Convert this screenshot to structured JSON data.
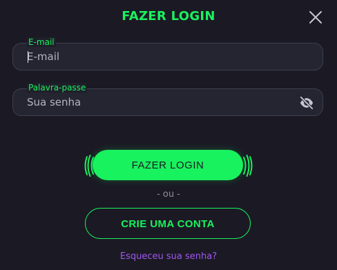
{
  "modal": {
    "title": "FAZER LOGIN"
  },
  "email": {
    "label": "E-mail",
    "placeholder": "E-mail",
    "value": ""
  },
  "password": {
    "label": "Palavra-passe",
    "placeholder": "Sua senha",
    "value": ""
  },
  "actions": {
    "login_label": "FAZER LOGIN",
    "or_label": "- ou -",
    "create_account_label": "CRIE UMA CONTA",
    "forgot_password_label": "Esqueceu sua senha?"
  },
  "icons": {
    "close": "close-icon",
    "toggle_password": "eye-off-icon"
  },
  "colors": {
    "accent": "#19f25f",
    "link": "#a156f0",
    "background": "#1b1a24",
    "field_background": "#242531"
  }
}
